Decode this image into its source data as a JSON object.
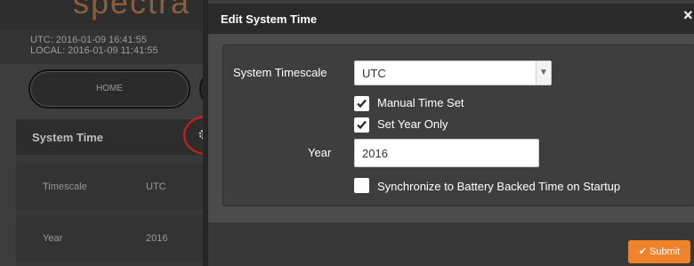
{
  "background_app": {
    "logo_text": "spectra",
    "utc_time": "UTC: 2016-01-09 16:41:55",
    "local_time": "LOCAL: 2016-01-09 11:41:55",
    "home_label": "HOME",
    "panel_title": "System Time",
    "rows": [
      {
        "key": "Timescale",
        "value": "UTC"
      },
      {
        "key": "Year",
        "value": "2016"
      }
    ]
  },
  "modal": {
    "title": "Edit System Time",
    "close_label": "×",
    "timescale_label": "System Timescale",
    "timescale_value": "UTC",
    "manual_time_label": "Manual Time Set",
    "manual_time_checked": true,
    "year_only_label": "Set Year Only",
    "year_only_checked": true,
    "year_label": "Year",
    "year_value": "2016",
    "sync_label": "Synchronize to Battery Backed Time on Startup",
    "sync_checked": false,
    "submit_label": "✔ Submit"
  },
  "colors": {
    "accent": "#f0832a",
    "highlight_circle": "#d41d1d"
  }
}
